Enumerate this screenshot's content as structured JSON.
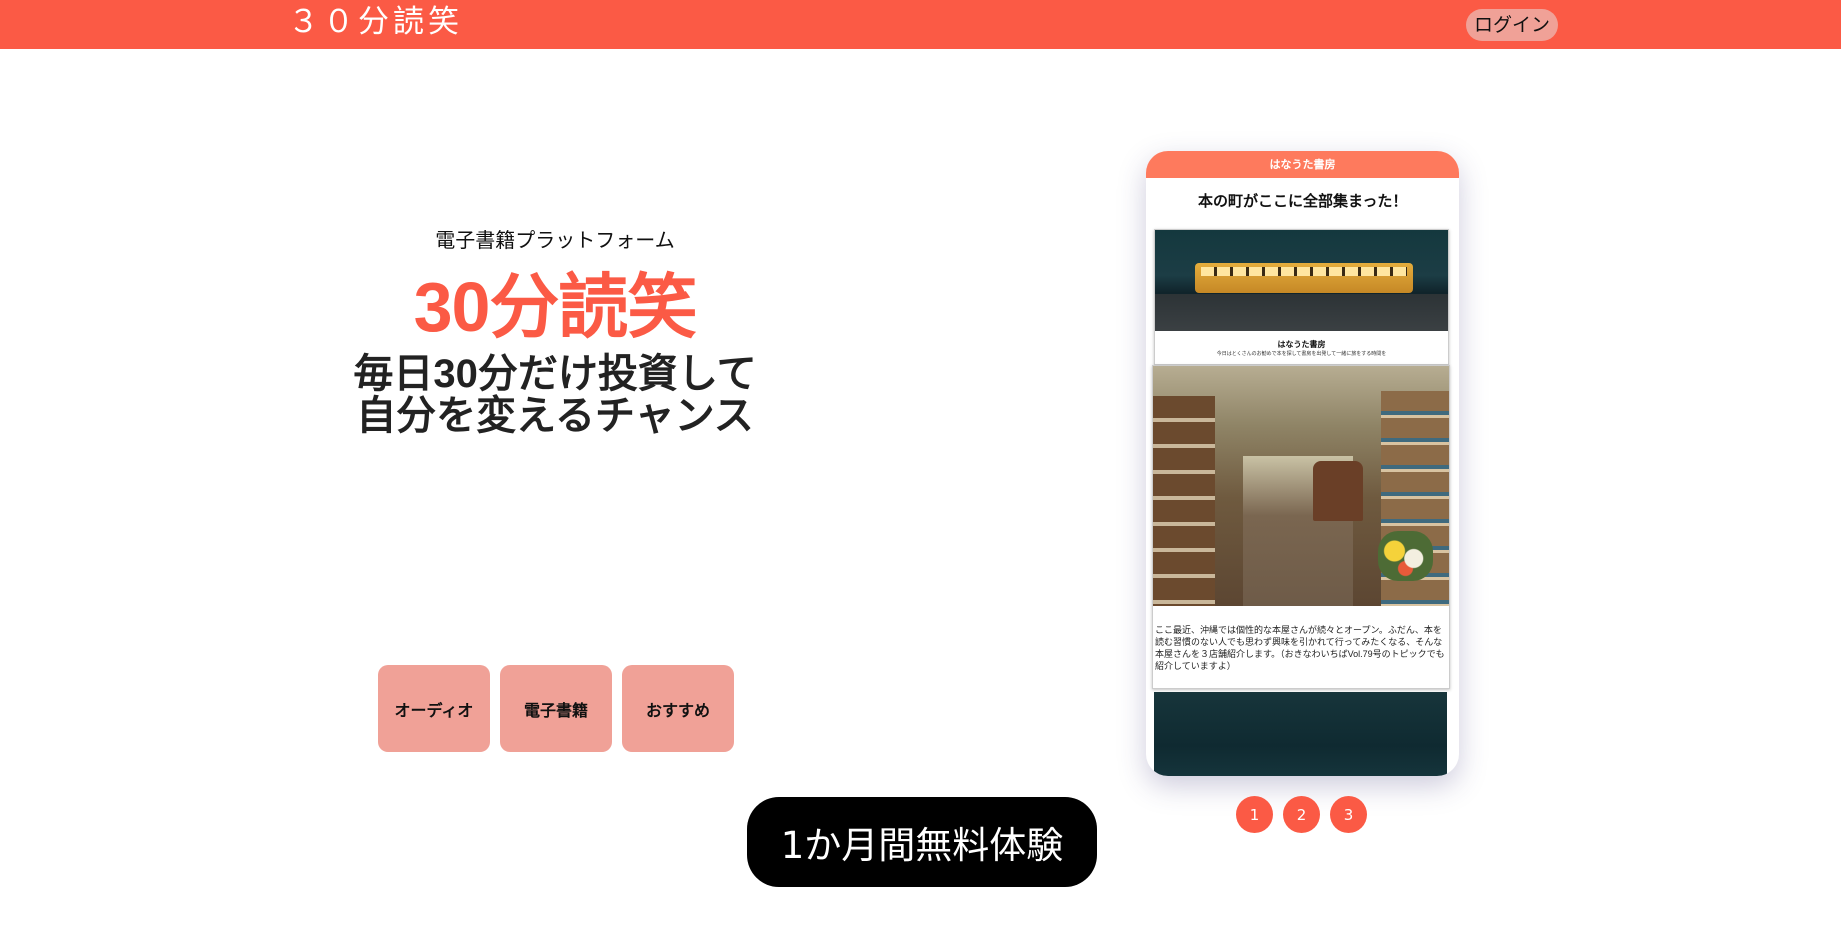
{
  "header": {
    "brand": "３０分読笑",
    "login_label": "ログイン"
  },
  "hero": {
    "subtitle": "電子書籍プラットフォーム",
    "title": "30分読笑",
    "tagline": "毎日30分だけ投資して\n自分を変えるチャンス"
  },
  "categories": [
    {
      "label": "オーディオ"
    },
    {
      "label": "電子書籍"
    },
    {
      "label": "おすすめ"
    }
  ],
  "cta": {
    "label": "1か月間無料体験"
  },
  "phone": {
    "bar_title": "はなうた書房",
    "heading": "本の町がここに全部集まった！",
    "card1": {
      "title": "はなうた書房",
      "desc": "今日はとくさんのお勧めで本を探して書房を出発して一緒に旅をする時間を"
    },
    "card2": {
      "text": "ここ最近、沖縄では個性的な本屋さんが続々とオープン。ふだん、本を読む習慣のない人でも思わず興味を引かれて行ってみたくなる、そんな本屋さんを３店舗紹介します。（おきなわいちばVol.79号のトピックでも紹介していますよ）"
    }
  },
  "pager": [
    {
      "label": "1"
    },
    {
      "label": "2"
    },
    {
      "label": "3"
    }
  ],
  "colors": {
    "accent": "#fb5a45",
    "accent_soft": "#f0a197",
    "phone_bar": "#fe7a5d",
    "cta_bg": "#000000"
  }
}
